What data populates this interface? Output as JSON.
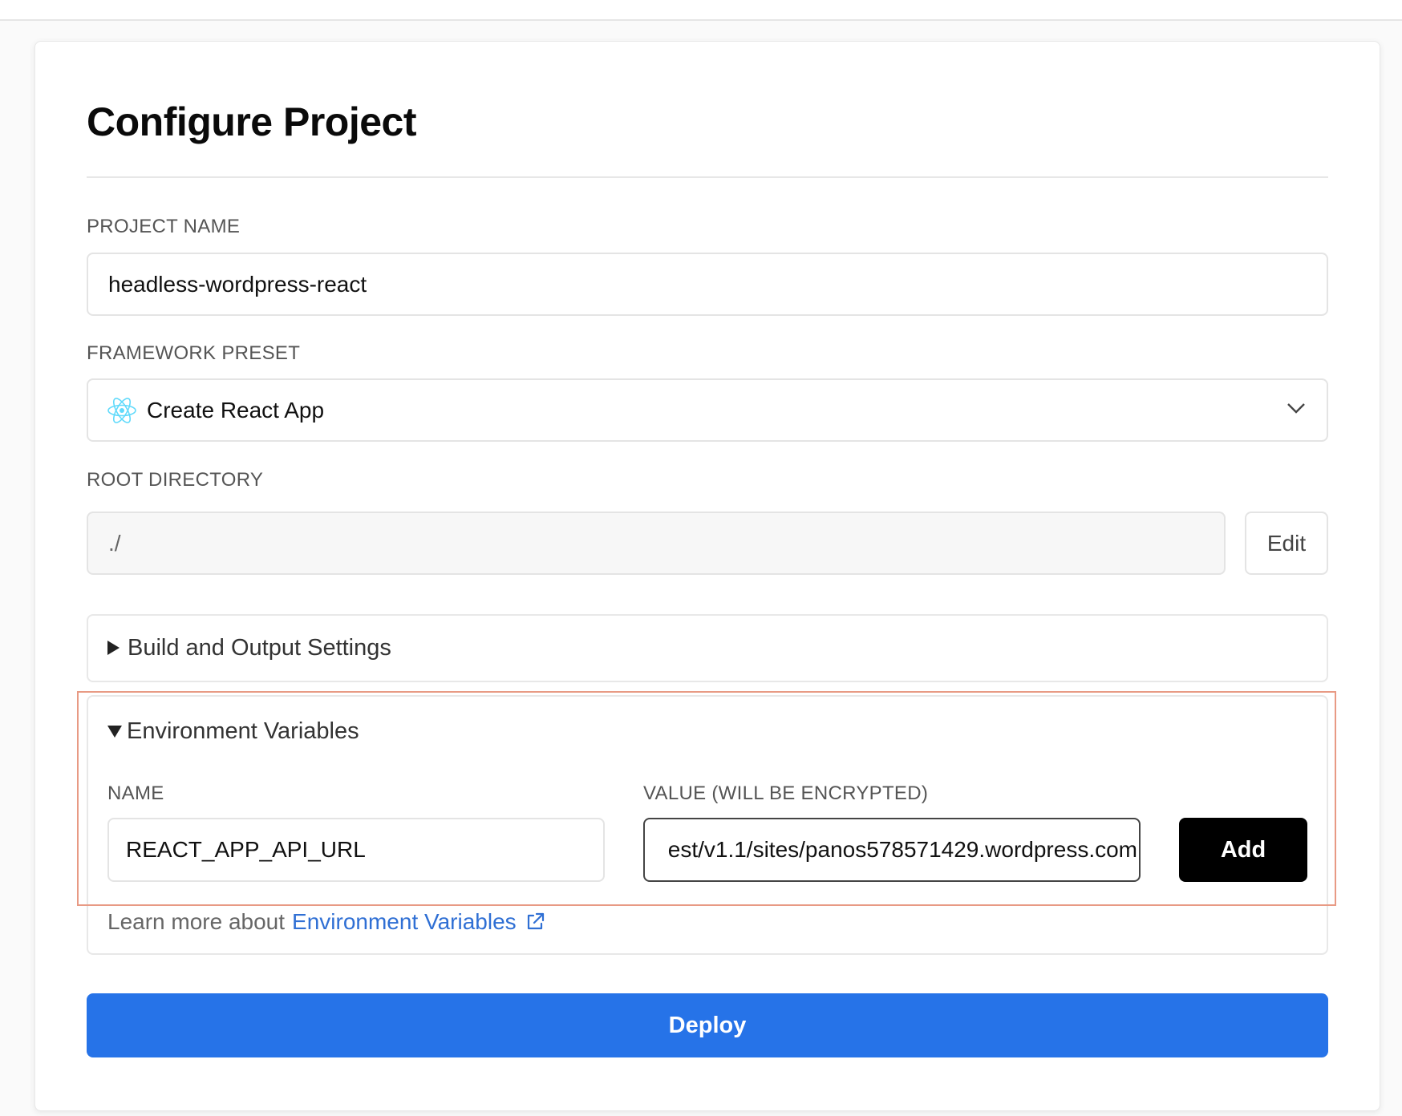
{
  "page": {
    "title": "Configure Project"
  },
  "project_name": {
    "label": "PROJECT NAME",
    "value": "headless-wordpress-react"
  },
  "framework_preset": {
    "label": "FRAMEWORK PRESET",
    "value": "Create React App",
    "icon": "react-logo-icon"
  },
  "root_directory": {
    "label": "ROOT DIRECTORY",
    "value": "./",
    "edit_label": "Edit"
  },
  "build_settings": {
    "label": "Build and Output Settings",
    "expanded": false
  },
  "env_vars": {
    "label": "Environment Variables",
    "expanded": true,
    "name_label": "NAME",
    "value_label": "VALUE (WILL BE ENCRYPTED)",
    "name_value": "REACT_APP_API_URL",
    "value_value": "est/v1.1/sites/panos578571429.wordpress.com",
    "add_label": "Add",
    "learn_prefix": "Learn more about",
    "learn_link": "Environment Variables"
  },
  "deploy": {
    "label": "Deploy"
  },
  "colors": {
    "accent": "#2673e8",
    "link": "#2f6fd4",
    "highlight_border": "#e89a84"
  }
}
